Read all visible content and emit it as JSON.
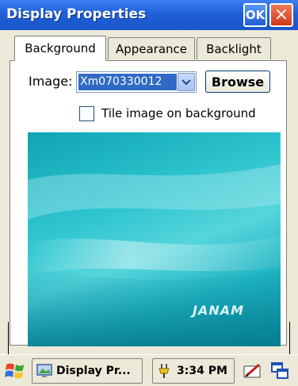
{
  "window": {
    "title": "Display Properties",
    "ok_label": "OK",
    "close_label": "×"
  },
  "tabs": [
    {
      "label": "Background",
      "active": true
    },
    {
      "label": "Appearance",
      "active": false
    },
    {
      "label": "Backlight",
      "active": false
    }
  ],
  "background": {
    "image_label": "Image:",
    "image_value": "Xm070330012",
    "browse_label": "Browse",
    "tile_label": "Tile image on background",
    "tile_checked": false,
    "preview_brand": "JANAM"
  },
  "taskbar": {
    "task_label": "Display Pr...",
    "clock": "3:34 PM"
  },
  "colors": {
    "titlebar": "#1f5fd9",
    "selection": "#316ac5",
    "preview": "#2ec5cf"
  }
}
